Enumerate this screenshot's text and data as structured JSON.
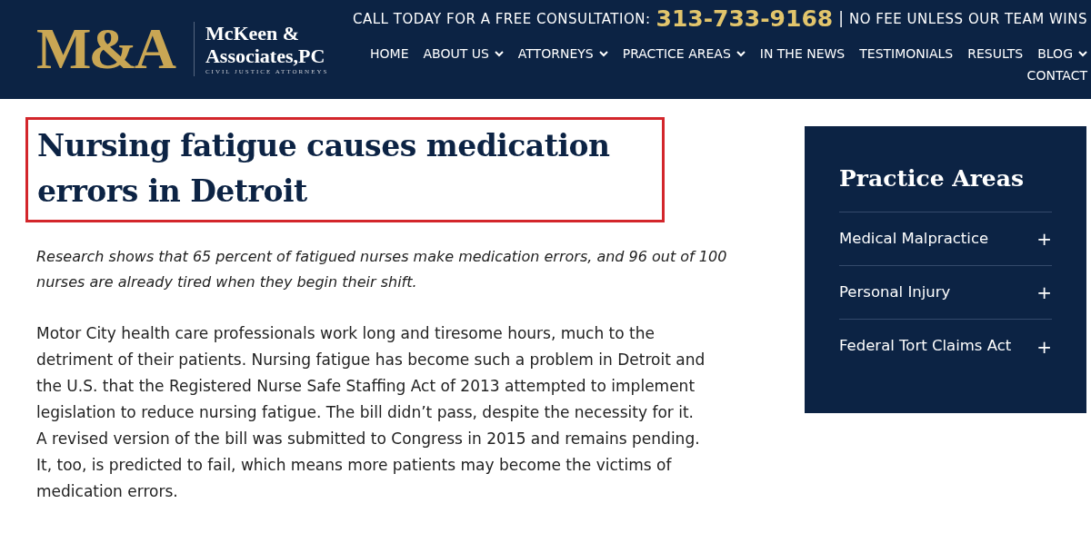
{
  "logo": {
    "monogram": "M&A",
    "name_line_1": "McKeen &",
    "name_line_2": "Associates,PC",
    "tagline": "CIVIL JUSTICE ATTORNEYS"
  },
  "top_bar": {
    "call_text": "CALL TODAY FOR A FREE CONSULTATION:",
    "phone": "313-733-9168",
    "separator": "|",
    "fee_text": "NO FEE UNLESS OUR TEAM WINS"
  },
  "nav": [
    {
      "label": "HOME",
      "dropdown": false
    },
    {
      "label": "ABOUT US",
      "dropdown": true
    },
    {
      "label": "ATTORNEYS",
      "dropdown": true
    },
    {
      "label": "PRACTICE AREAS",
      "dropdown": true
    },
    {
      "label": "IN THE NEWS",
      "dropdown": false
    },
    {
      "label": "TESTIMONIALS",
      "dropdown": false
    },
    {
      "label": "RESULTS",
      "dropdown": false
    },
    {
      "label": "BLOG",
      "dropdown": true
    },
    {
      "label": "CONTACT",
      "dropdown": false
    }
  ],
  "article": {
    "title": "Nursing fatigue causes medication errors in Detroit",
    "title_highlighted": true,
    "intro": "Research shows that 65 percent of fatigued nurses make medication errors, and 96 out of 100 nurses are already tired when they begin their shift.",
    "paragraphs": [
      "Motor City health care professionals work long and tiresome hours, much to the detriment of their patients. Nursing fatigue has become such a problem in Detroit and the U.S. that the Registered Nurse Safe Staffing Act of 2013 attempted to implement legislation to reduce nursing fatigue. The bill didn’t pass, despite the necessity for it. A revised version of the bill was submitted to Congress in 2015 and remains pending. It, too, is predicted to fail, which means more patients may become the victims of medication errors."
    ]
  },
  "sidebar": {
    "title": "Practice Areas",
    "items": [
      {
        "label": "Medical Malpractice",
        "toggle": "+"
      },
      {
        "label": "Personal Injury",
        "toggle": "+"
      },
      {
        "label": "Federal Tort Claims Act",
        "toggle": "+"
      }
    ]
  }
}
